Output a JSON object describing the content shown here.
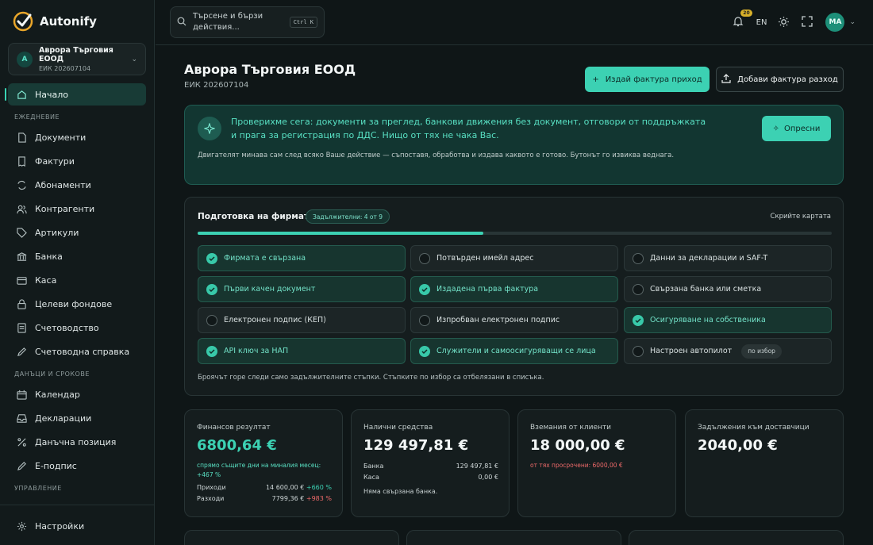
{
  "app": {
    "name": "Autonify"
  },
  "company": {
    "initial": "A",
    "name": "Аврора Търговия ЕООД",
    "eik": "ЕИК 202607104"
  },
  "sidebar": {
    "main_items": [
      {
        "label": "Начало",
        "icon": "home-icon",
        "active": true
      },
      {
        "label": "Документи",
        "icon": "document-icon"
      },
      {
        "label": "Фактури",
        "icon": "receipt-icon"
      },
      {
        "label": "Абонаменти",
        "icon": "refresh-icon"
      },
      {
        "label": "Контрагенти",
        "icon": "users-icon"
      },
      {
        "label": "Артикули",
        "icon": "tag-icon"
      },
      {
        "label": "Банка",
        "icon": "bank-icon"
      },
      {
        "label": "Каса",
        "icon": "cash-icon"
      },
      {
        "label": "Целеви фондове",
        "icon": "lock-icon"
      },
      {
        "label": "Счетоводство",
        "icon": "ledger-icon"
      },
      {
        "label": "Счетоводна справка",
        "icon": "pen-icon"
      }
    ],
    "section_daily": "ЕЖЕДНЕВИЕ",
    "section_tax": "ДАНЪЦИ И СРОКОВЕ",
    "tax_items": [
      {
        "label": "Календар",
        "icon": "calendar-icon"
      },
      {
        "label": "Декларации",
        "icon": "tray-icon"
      },
      {
        "label": "Данъчна позиция",
        "icon": "percent-icon"
      },
      {
        "label": "Е-подпис",
        "icon": "pen-icon"
      }
    ],
    "section_manage": "УПРАВЛЕНИЕ",
    "settings_label": "Настройки"
  },
  "topbar": {
    "search_placeholder": "Търсене и бързи действия...",
    "shortcut": "Ctrl K",
    "notifications": "20",
    "lang": "EN",
    "user_initials": "МА"
  },
  "header": {
    "title": "Аврора Търговия ЕООД",
    "subtitle": "ЕИК 202607104",
    "issue_invoice": "Издай фактура приход",
    "add_expense": "Добави фактура разход"
  },
  "notice": {
    "title": "Проверихме сега: документи за преглед, банкови движения без документ, отговори от поддръжката и прага за регистрация по ДДС. Нищо от тях не чака Вас.",
    "body": "Двигателят минава сам след всяко Ваше действие — съпоставя, обработва и издава каквото е готово. Бутонът го извиква веднага.",
    "refresh": "Опресни"
  },
  "setup": {
    "title": "Подготовка на фирмата",
    "required_pill": "Задължителни: 4 от 9",
    "hide": "Скрийте картата",
    "progress": 0.45,
    "steps": [
      {
        "label": "Фирмата е свързана",
        "done": true
      },
      {
        "label": "Потвърден имейл адрес",
        "done": false
      },
      {
        "label": "Данни за декларации и SAF-T",
        "done": false
      },
      {
        "label": "Първи качен документ",
        "done": true
      },
      {
        "label": "Издадена първа фактура",
        "done": true
      },
      {
        "label": "Свързана банка или сметка",
        "done": false
      },
      {
        "label": "Електронен подпис (КЕП)",
        "done": false
      },
      {
        "label": "Изпробван електронен подпис",
        "done": false
      },
      {
        "label": "Осигуряване на собственика",
        "done": true
      },
      {
        "label": "API ключ за НАП",
        "done": true
      },
      {
        "label": "Служители и самоосигуряващи се лица",
        "done": true
      },
      {
        "label": "Настроен автопилот",
        "done": false,
        "optional": "по избор"
      }
    ],
    "footer": "Броячът горе следи само задължителните стъпки. Стъпките по избор са отбелязани в списъка."
  },
  "cards": {
    "result": {
      "title": "Финансов резултат",
      "value": "6800,64 €",
      "note": "спрямо същите дни на миналия месец: +467 %",
      "income_label": "Приходи",
      "income_value": "14 600,00 €",
      "income_change": "+660 %",
      "expense_label": "Разходи",
      "expense_value": "7799,36 €",
      "expense_change": "+983 %"
    },
    "cash": {
      "title": "Налични средства",
      "value": "129 497,81 €",
      "bank_label": "Банка",
      "bank_value": "129 497,81 €",
      "cash_label": "Каса",
      "cash_value": "0,00 €",
      "note": "Няма свързана банка."
    },
    "receivables": {
      "title": "Вземания от клиенти",
      "value": "18 000,00 €",
      "note": "от тях просрочени: 6000,00 €"
    },
    "payables": {
      "title": "Задължения към доставчици",
      "value": "2040,00 €"
    }
  },
  "colors": {
    "accent": "#3cd1b3",
    "background": "#0f1617",
    "danger": "#ef6a6a",
    "badge": "#d7b02a"
  }
}
